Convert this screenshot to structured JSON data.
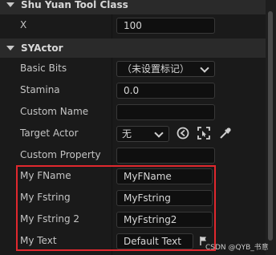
{
  "categories": {
    "tool_class": {
      "title": "Shu Yuan Tool Class"
    },
    "actor": {
      "title": "SYActor"
    }
  },
  "rows": {
    "x": {
      "label": "X",
      "value": "100"
    },
    "basic_bits": {
      "label": "Basic Bits",
      "value": "（未设置标记）"
    },
    "stamina": {
      "label": "Stamina",
      "value": "0.0"
    },
    "custom_name": {
      "label": "Custom Name",
      "value": ""
    },
    "target_actor": {
      "label": "Target Actor",
      "value": "无"
    },
    "custom_property": {
      "label": "Custom Property",
      "value": ""
    },
    "my_fname": {
      "label": "My FName",
      "value": "MyFName"
    },
    "my_fstring": {
      "label": "My Fstring",
      "value": "MyFstring"
    },
    "my_fstring2": {
      "label": "My Fstring 2",
      "value": "MyFstring2"
    },
    "my_text": {
      "label": "My Text",
      "value": "Default Text"
    }
  },
  "icons": [
    "collapse-triangle-icon",
    "chevron-down-icon",
    "browse-arrow-icon",
    "select-in-viewport-icon",
    "eyedropper-icon",
    "localization-flag-icon"
  ],
  "colors": {
    "highlight": "#e0282e",
    "panel_bg": "#1a1a1a",
    "field_bg": "#0f0f0f"
  },
  "watermark": "CSDN @QYB_书意"
}
